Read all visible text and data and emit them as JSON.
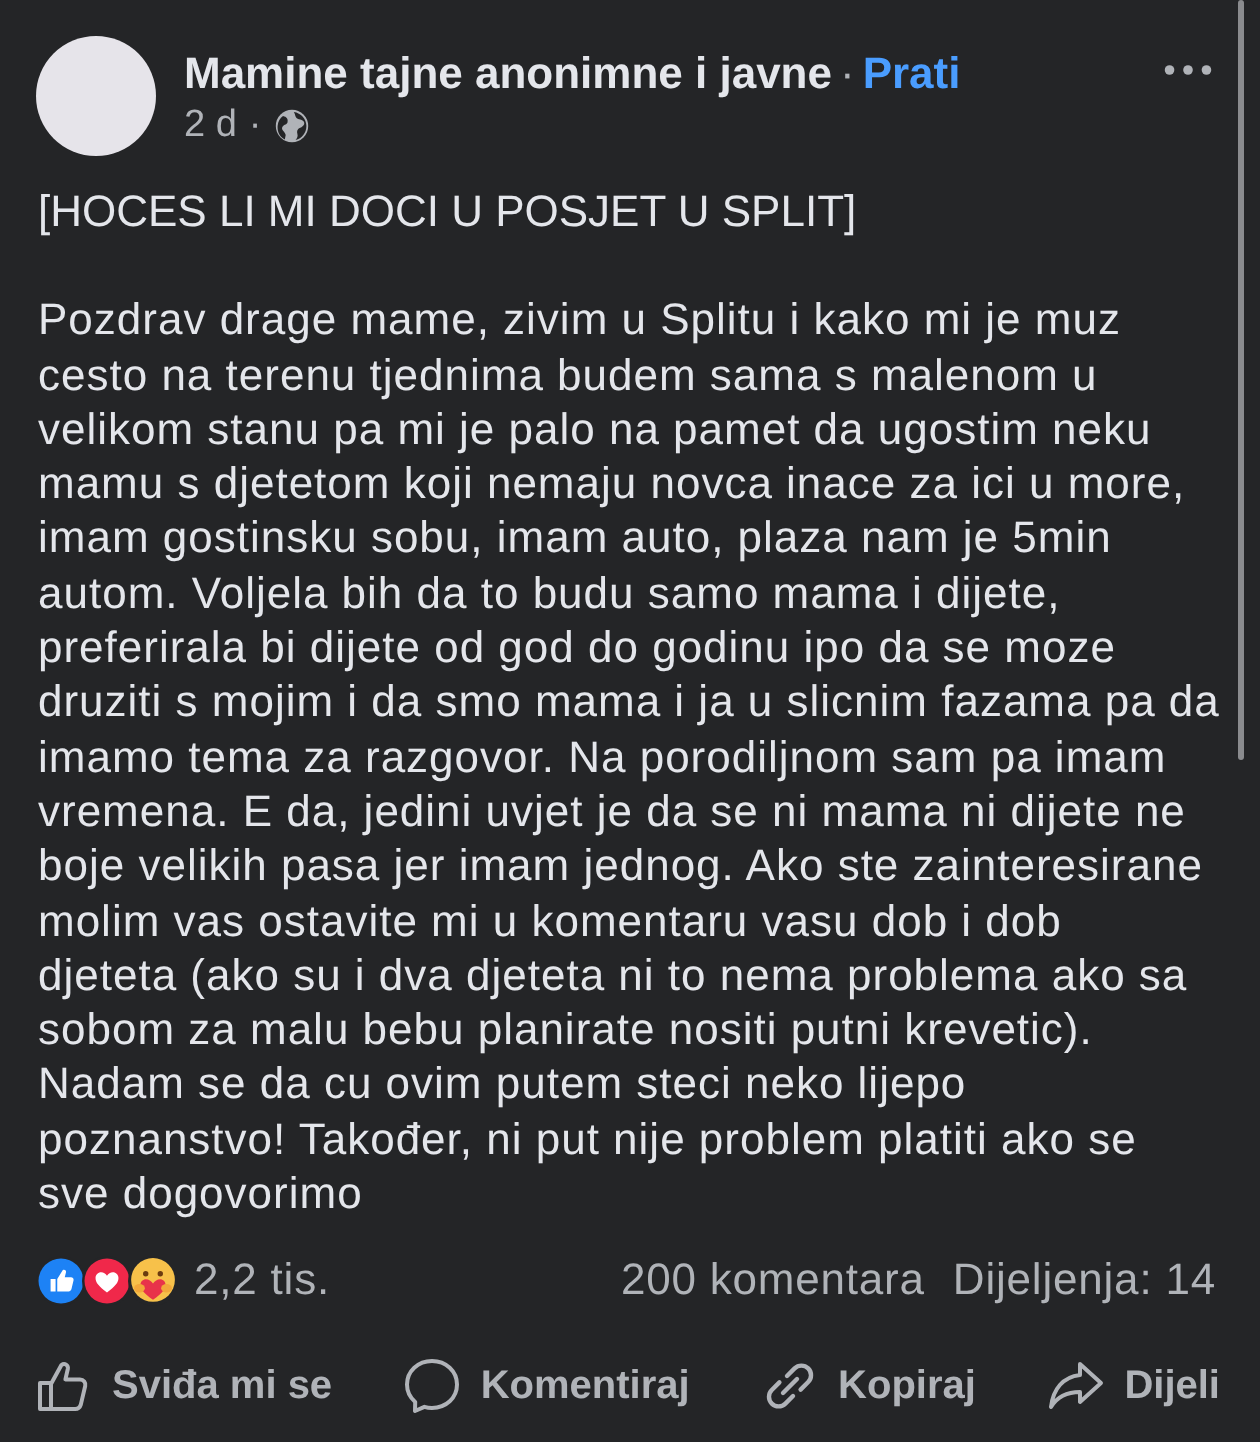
{
  "post": {
    "author": "Mamine tajne anonimne i javne",
    "separator": "·",
    "follow_link": "Prati",
    "time": "2 d",
    "time_separator": "·",
    "title": "[HOCES LI MI DOCI U POSJET U SPLIT]",
    "body": "Pozdrav drage mame, zivim u Splitu i kako mi je muz\ncesto na terenu tjednima budem sama s malenom u\nvelikom stanu pa mi je palo na pamet da ugostim neku\nmamu s djetetom koji nemaju novca inace za ici u more,\nimam gostinsku sobu, imam auto, plaza nam je 5min\nautom. Voljela bih da to budu samo mama i dijete,\npreferirala bi dijete od god do godinu ipo da se moze\ndruziti s mojim i da smo mama i ja u slicnim fazama pa da\nimamo tema za razgovor. Na porodiljnom sam pa imam\nvremena. E da, jedini uvjet je da se ni mama ni dijete ne\nboje velikih pasa jer imam jednog. Ako ste zainteresirane\nmolim vas ostavite mi u komentaru vasu dob i dob\ndjeteta (ako su i dva djeteta ni to nema problema ako sa\nsobom za malu bebu planirate nositi putni krevetic).\nNadam se da cu ovim putem steci neko lijepo\npoznanstvo! Također, ni put nije problem platiti ako se\nsve dogovorimo"
  },
  "reactions": {
    "types": [
      {
        "kind": "like"
      },
      {
        "kind": "love"
      },
      {
        "kind": "care"
      }
    ],
    "count": "2,2 tis.",
    "comments": "200 komentara",
    "shares": "Dijeljenja: 14"
  },
  "actions": [
    {
      "kind": "like",
      "label": "Sviđa mi se"
    },
    {
      "kind": "comment",
      "label": "Komentiraj"
    },
    {
      "kind": "link",
      "label": "Kopiraj"
    },
    {
      "kind": "share",
      "label": "Dijeli"
    }
  ]
}
